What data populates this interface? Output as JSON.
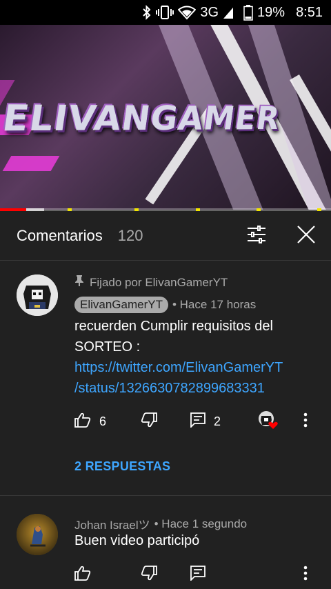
{
  "status_bar": {
    "network": "3G",
    "battery": "19%",
    "time": "8:51"
  },
  "video": {
    "overlay_title": "ELIVANGAMER",
    "progress_fraction": 0.08
  },
  "comments_panel": {
    "title": "Comentarios",
    "count": "120"
  },
  "comments": [
    {
      "pinned_label": "Fijado por ElivanGamerYT",
      "author": "ElivanGamerYT",
      "time": "• Hace 17 horas",
      "text_line1": "recuerden Cumplir requisitos del",
      "text_line2": "SORTEO :",
      "link_line1": "https://twitter.com/ElivanGamerYT",
      "link_line2": "/status/1326630782899683331",
      "likes": "6",
      "reply_count": "2",
      "replies_label": "2 RESPUESTAS"
    },
    {
      "author": "Johan Israelツ",
      "time": "• Hace 1 segundo",
      "text": "Buen video participó"
    }
  ],
  "icons": {
    "bluetooth": "bluetooth-icon",
    "vibrate": "vibrate-icon",
    "wifi": "wifi-icon",
    "signal": "signal-icon",
    "battery": "battery-icon",
    "filter": "sort-filter-icon",
    "close": "close-icon",
    "pin": "pin-icon",
    "like": "thumbs-up-icon",
    "dislike": "thumbs-down-icon",
    "reply": "reply-comment-icon",
    "more": "more-vert-icon",
    "creator_heart": "creator-heart-icon"
  },
  "colors": {
    "background": "#212121",
    "link": "#3ea6ff",
    "secondary_text": "#aaaaaa",
    "progress": "#ff0000",
    "ad_marker": "#f2e600",
    "heart": "#ff0000"
  }
}
